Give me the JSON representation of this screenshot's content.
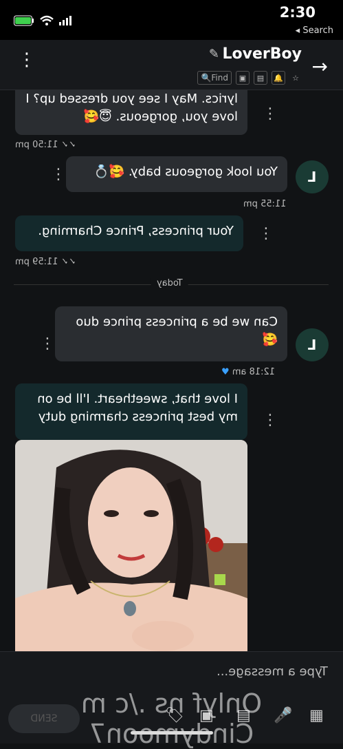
{
  "status": {
    "time": "2:30",
    "back_label": "Search"
  },
  "header": {
    "title": "LoverBoy",
    "find_label": "Find"
  },
  "messages": [
    {
      "text": "lyrics. May I see you dressed up? I love you, gorgeous. 😇🥰",
      "time": "11:50 pm"
    },
    {
      "text": "You look gorgeous baby. 🥰💍",
      "time": "11:55 pm",
      "avatar": "L"
    },
    {
      "text": "Your princess, Prince Charming.",
      "time": "11:59 pm"
    },
    {
      "text": "Can we be a princess prince duo 🥰",
      "time": "12:18 am",
      "avatar": "L"
    },
    {
      "text": "I love that, sweetheart. I'll be on my best princess charming duty"
    }
  ],
  "day_divider": "Today",
  "input": {
    "placeholder": "Type a message...",
    "send_label": "SEND"
  },
  "watermark": "Onlyf ns ./c m Cindymoon7"
}
